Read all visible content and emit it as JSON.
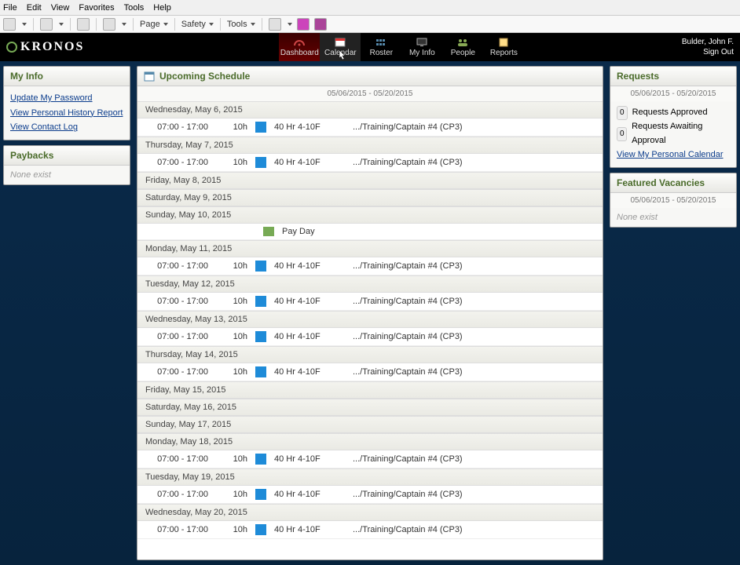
{
  "menu": {
    "items": [
      "File",
      "Edit",
      "View",
      "Favorites",
      "Tools",
      "Help"
    ]
  },
  "toolbar": {
    "page": "Page",
    "safety": "Safety",
    "tools": "Tools"
  },
  "brand": "KRONOS",
  "nav": [
    {
      "label": "Dashboard",
      "active": true
    },
    {
      "label": "Calendar",
      "current": true
    },
    {
      "label": "Roster"
    },
    {
      "label": "My Info"
    },
    {
      "label": "People"
    },
    {
      "label": "Reports"
    }
  ],
  "user": {
    "name": "Bulder, John F.",
    "signout": "Sign Out"
  },
  "sidebar_left": {
    "myinfo": {
      "title": "My Info",
      "links": [
        "Update My Password",
        "View Personal History Report",
        "View Contact Log"
      ]
    },
    "paybacks": {
      "title": "Paybacks",
      "none": "None exist"
    }
  },
  "schedule": {
    "title": "Upcoming Schedule",
    "date_range": "05/06/2015 - 05/20/2015",
    "days": [
      {
        "label": "Wednesday, May 6, 2015",
        "shifts": [
          {
            "time": "07:00 - 17:00",
            "hours": "10h",
            "color": "#1e8bd8",
            "code": "40 Hr 4-10F",
            "desc": ".../Training/Captain #4 (CP3)"
          }
        ]
      },
      {
        "label": "Thursday, May 7, 2015",
        "shifts": [
          {
            "time": "07:00 - 17:00",
            "hours": "10h",
            "color": "#1e8bd8",
            "code": "40 Hr 4-10F",
            "desc": ".../Training/Captain #4 (CP3)"
          }
        ]
      },
      {
        "label": "Friday, May 8, 2015",
        "shifts": []
      },
      {
        "label": "Saturday, May 9, 2015",
        "shifts": []
      },
      {
        "label": "Sunday, May 10, 2015",
        "shifts": [],
        "payday": "Pay Day"
      },
      {
        "label": "Monday, May 11, 2015",
        "shifts": [
          {
            "time": "07:00 - 17:00",
            "hours": "10h",
            "color": "#1e8bd8",
            "code": "40 Hr 4-10F",
            "desc": ".../Training/Captain #4 (CP3)"
          }
        ]
      },
      {
        "label": "Tuesday, May 12, 2015",
        "shifts": [
          {
            "time": "07:00 - 17:00",
            "hours": "10h",
            "color": "#1e8bd8",
            "code": "40 Hr 4-10F",
            "desc": ".../Training/Captain #4 (CP3)"
          }
        ]
      },
      {
        "label": "Wednesday, May 13, 2015",
        "shifts": [
          {
            "time": "07:00 - 17:00",
            "hours": "10h",
            "color": "#1e8bd8",
            "code": "40 Hr 4-10F",
            "desc": ".../Training/Captain #4 (CP3)"
          }
        ]
      },
      {
        "label": "Thursday, May 14, 2015",
        "shifts": [
          {
            "time": "07:00 - 17:00",
            "hours": "10h",
            "color": "#1e8bd8",
            "code": "40 Hr 4-10F",
            "desc": ".../Training/Captain #4 (CP3)"
          }
        ]
      },
      {
        "label": "Friday, May 15, 2015",
        "shifts": []
      },
      {
        "label": "Saturday, May 16, 2015",
        "shifts": []
      },
      {
        "label": "Sunday, May 17, 2015",
        "shifts": []
      },
      {
        "label": "Monday, May 18, 2015",
        "shifts": [
          {
            "time": "07:00 - 17:00",
            "hours": "10h",
            "color": "#1e8bd8",
            "code": "40 Hr 4-10F",
            "desc": ".../Training/Captain #4 (CP3)"
          }
        ]
      },
      {
        "label": "Tuesday, May 19, 2015",
        "shifts": [
          {
            "time": "07:00 - 17:00",
            "hours": "10h",
            "color": "#1e8bd8",
            "code": "40 Hr 4-10F",
            "desc": ".../Training/Captain #4 (CP3)"
          }
        ]
      },
      {
        "label": "Wednesday, May 20, 2015",
        "shifts": [
          {
            "time": "07:00 - 17:00",
            "hours": "10h",
            "color": "#1e8bd8",
            "code": "40 Hr 4-10F",
            "desc": ".../Training/Captain #4 (CP3)"
          }
        ]
      }
    ]
  },
  "sidebar_right": {
    "requests": {
      "title": "Requests",
      "date_range": "05/06/2015 - 05/20/2015",
      "approved": {
        "count": "0",
        "label": "Requests Approved"
      },
      "awaiting": {
        "count": "0",
        "label": "Requests Awaiting Approval"
      },
      "link": "View My Personal Calendar"
    },
    "vacancies": {
      "title": "Featured Vacancies",
      "date_range": "05/06/2015 - 05/20/2015",
      "none": "None exist"
    }
  }
}
